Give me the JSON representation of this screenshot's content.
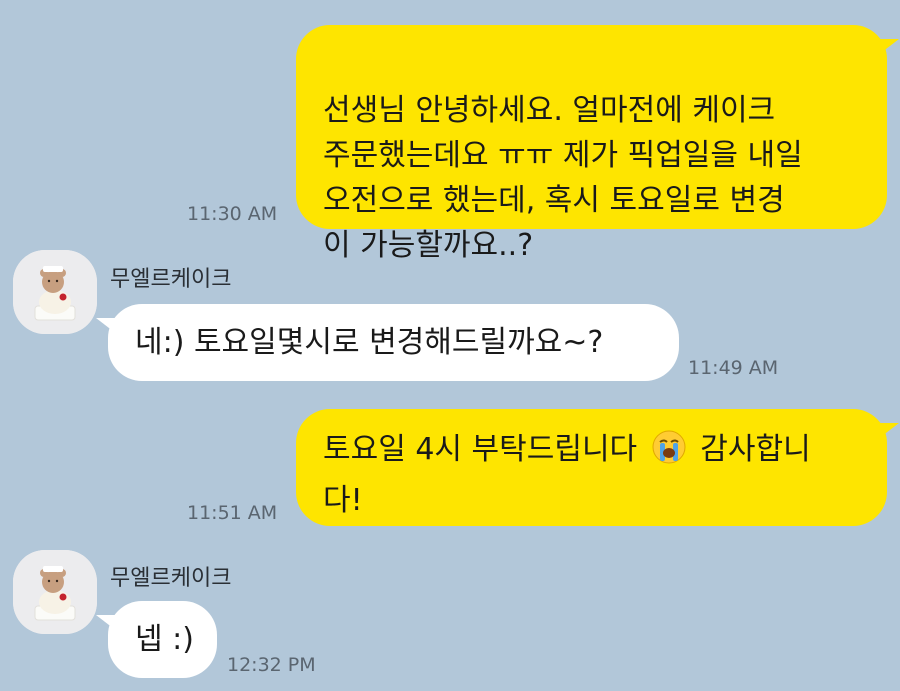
{
  "messages": [
    {
      "direction": "outgoing",
      "text": "선생님 안녕하세요. 얼마전에 케이크\n주문했는데요 ㅠㅠ 제가 픽업일을 내일\n오전으로 했는데, 혹시 토요일로 변경\n이 가능할까요..?",
      "time": "11:30 AM"
    },
    {
      "direction": "incoming",
      "sender": "무엘르케이크",
      "text": "네:) 토요일몇시로 변경해드릴까요~?",
      "time": "11:49 AM"
    },
    {
      "direction": "outgoing",
      "text_before_emoji": "토요일 4시 부탁드립니다",
      "emoji": "loudly-crying-face",
      "text_after_emoji_line1": "감사합니",
      "text_line2": "다!",
      "time": "11:51 AM"
    },
    {
      "direction": "incoming",
      "sender": "무엘르케이크",
      "text": "넵 :)",
      "time": "12:32 PM"
    }
  ],
  "colors": {
    "background": "#b2c7d9",
    "outgoing_bubble": "#fee500",
    "incoming_bubble": "#ffffff"
  }
}
